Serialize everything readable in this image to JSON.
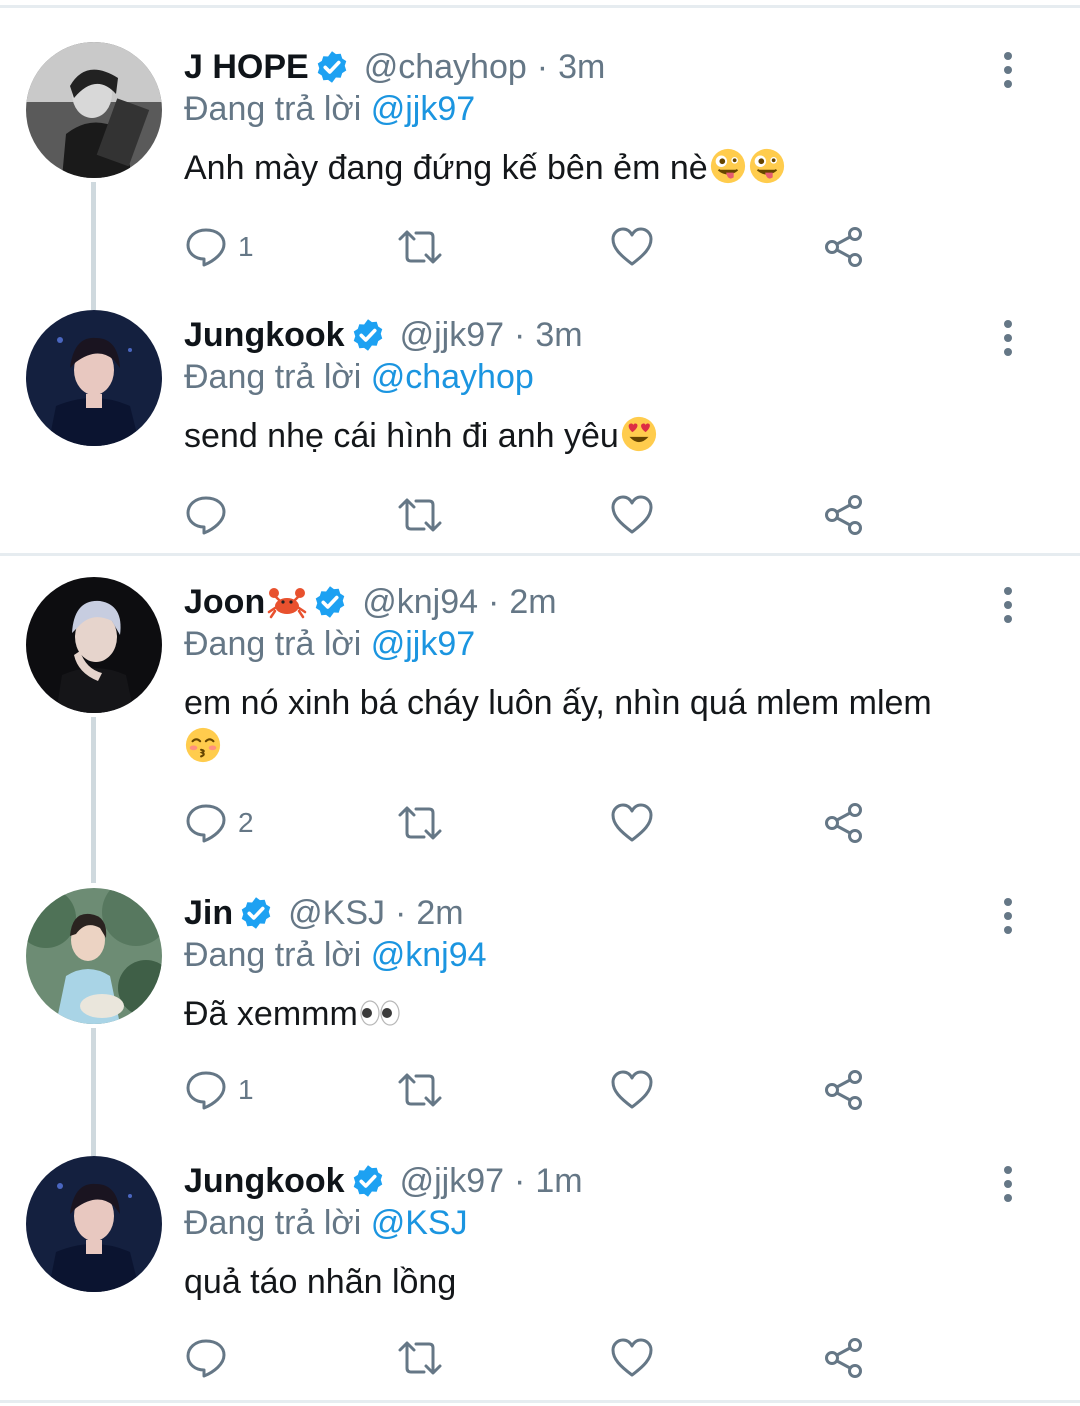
{
  "reply_prefix": "Đang trả lời",
  "colors": {
    "accent": "#1b95e0",
    "verified": "#1da1f2",
    "secondary_text": "#657786",
    "thread_line": "#cfd9de",
    "separator": "#e6ecf0"
  },
  "tweets": [
    {
      "name": "J HOPE",
      "handle": "@chayhop",
      "time": "3m",
      "reply_to": "@jjk97",
      "text": "Anh mày đang đứng kế bên ẻm nè",
      "emojis": [
        "zany-face",
        "zany-face"
      ],
      "reply_count": "1",
      "verified": true
    },
    {
      "name": "Jungkook",
      "handle": "@jjk97",
      "time": "3m",
      "reply_to": "@chayhop",
      "text": "send nhẹ cái hình đi anh yêu",
      "emojis": [
        "heart-eyes-face"
      ],
      "reply_count": "",
      "verified": true
    },
    {
      "name": "Joon",
      "name_emoji": "crab",
      "handle": "@knj94",
      "time": "2m",
      "reply_to": "@jjk97",
      "text": "em nó xinh bá cháy luôn ấy, nhìn quá mlem mlem",
      "emojis": [
        "kissing-face-closed-eyes"
      ],
      "reply_count": "2",
      "verified": true
    },
    {
      "name": "Jin",
      "handle": "@KSJ",
      "time": "2m",
      "reply_to": "@knj94",
      "text": "Đã xemmm",
      "emojis": [
        "eyes"
      ],
      "reply_count": "1",
      "verified": true
    },
    {
      "name": "Jungkook",
      "handle": "@jjk97",
      "time": "1m",
      "reply_to": "@KSJ",
      "text": "quả táo nhãn lồng",
      "emojis": [],
      "reply_count": "",
      "verified": true
    }
  ],
  "icons": {
    "reply": "speech-bubble-icon",
    "retweet": "retweet-arrows-icon",
    "like": "heart-outline-icon",
    "share": "share-nodes-icon",
    "more": "vertical-dots-icon",
    "verified": "verified-badge-icon"
  }
}
